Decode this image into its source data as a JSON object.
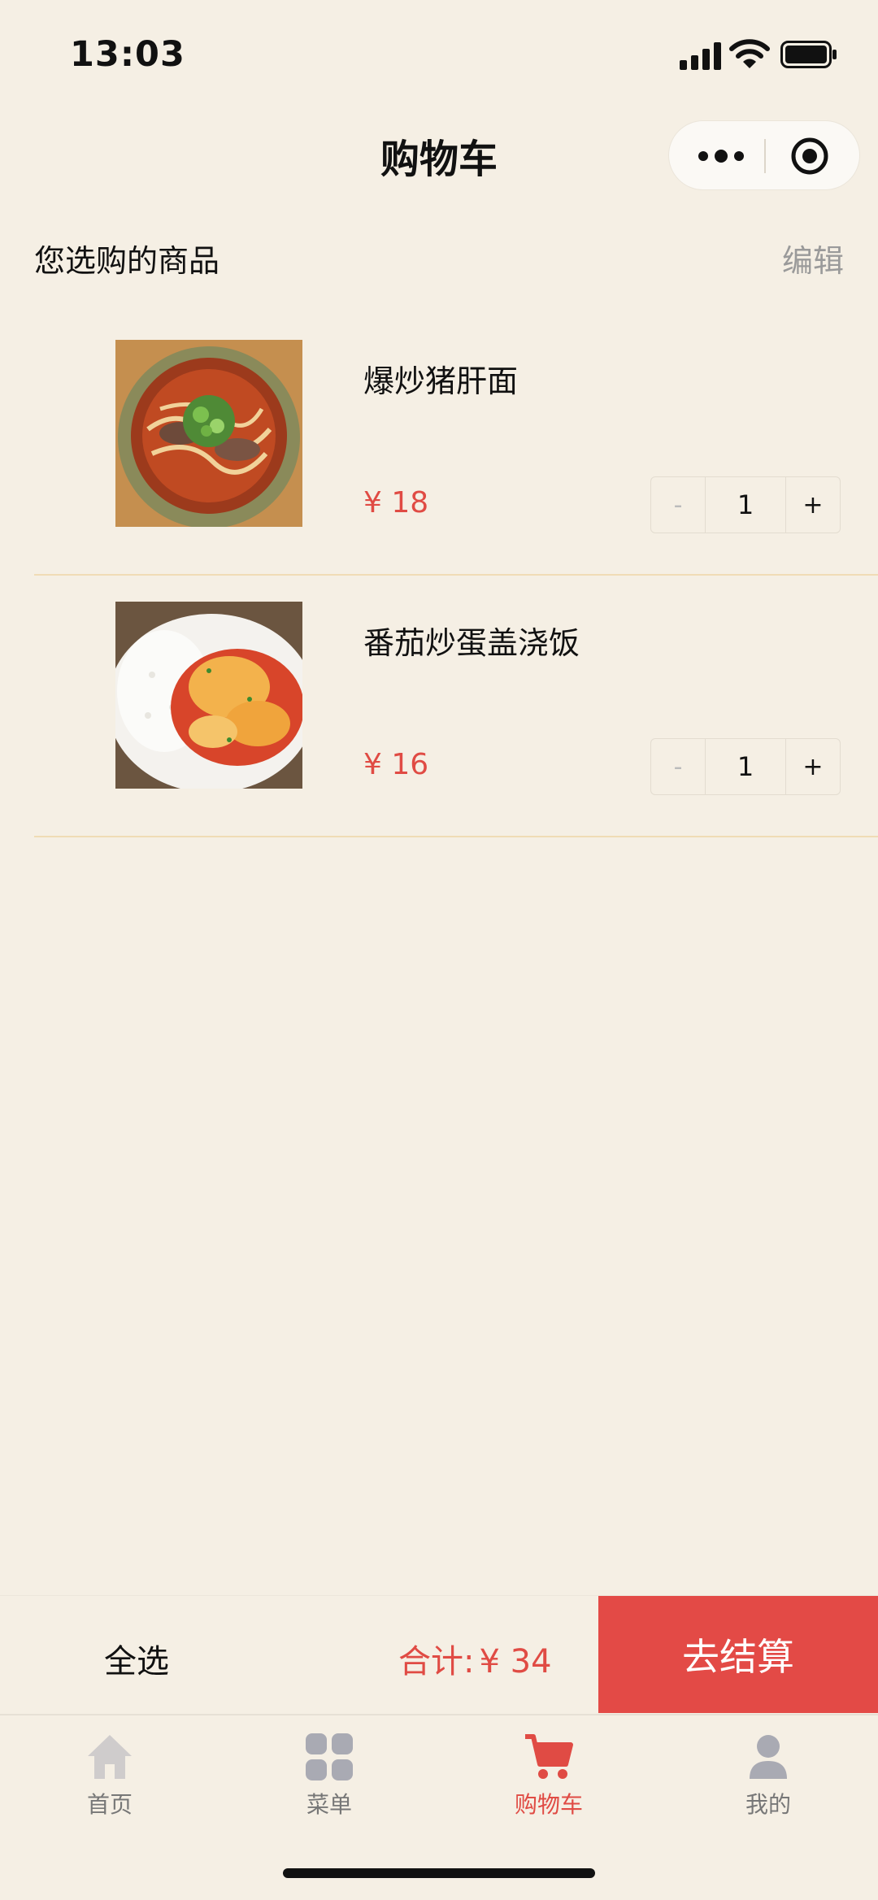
{
  "status_bar": {
    "time": "13:03"
  },
  "nav": {
    "title": "购物车"
  },
  "section": {
    "title": "您选购的商品",
    "edit_label": "编辑"
  },
  "cart": {
    "items": [
      {
        "name": "爆炒猪肝面",
        "price": "¥ 18",
        "quantity": "1",
        "minus": "-",
        "plus": "+",
        "thumbnail": "noodle-bowl-image"
      },
      {
        "name": "番茄炒蛋盖浇饭",
        "price": "¥ 16",
        "quantity": "1",
        "minus": "-",
        "plus": "+",
        "thumbnail": "tomato-egg-rice-image"
      }
    ]
  },
  "checkout": {
    "select_all": "全选",
    "total_label": "合计:",
    "total_value": "¥ 34",
    "button_label": "去结算"
  },
  "tabbar": {
    "tabs": [
      {
        "label": "首页",
        "icon": "home-icon"
      },
      {
        "label": "菜单",
        "icon": "grid-icon"
      },
      {
        "label": "购物车",
        "icon": "cart-icon",
        "active": true
      },
      {
        "label": "我的",
        "icon": "person-icon"
      }
    ]
  },
  "colors": {
    "background": "#f5efe4",
    "accent": "#e34a46",
    "price": "#e04b44",
    "separator": "#f0dcb5"
  }
}
